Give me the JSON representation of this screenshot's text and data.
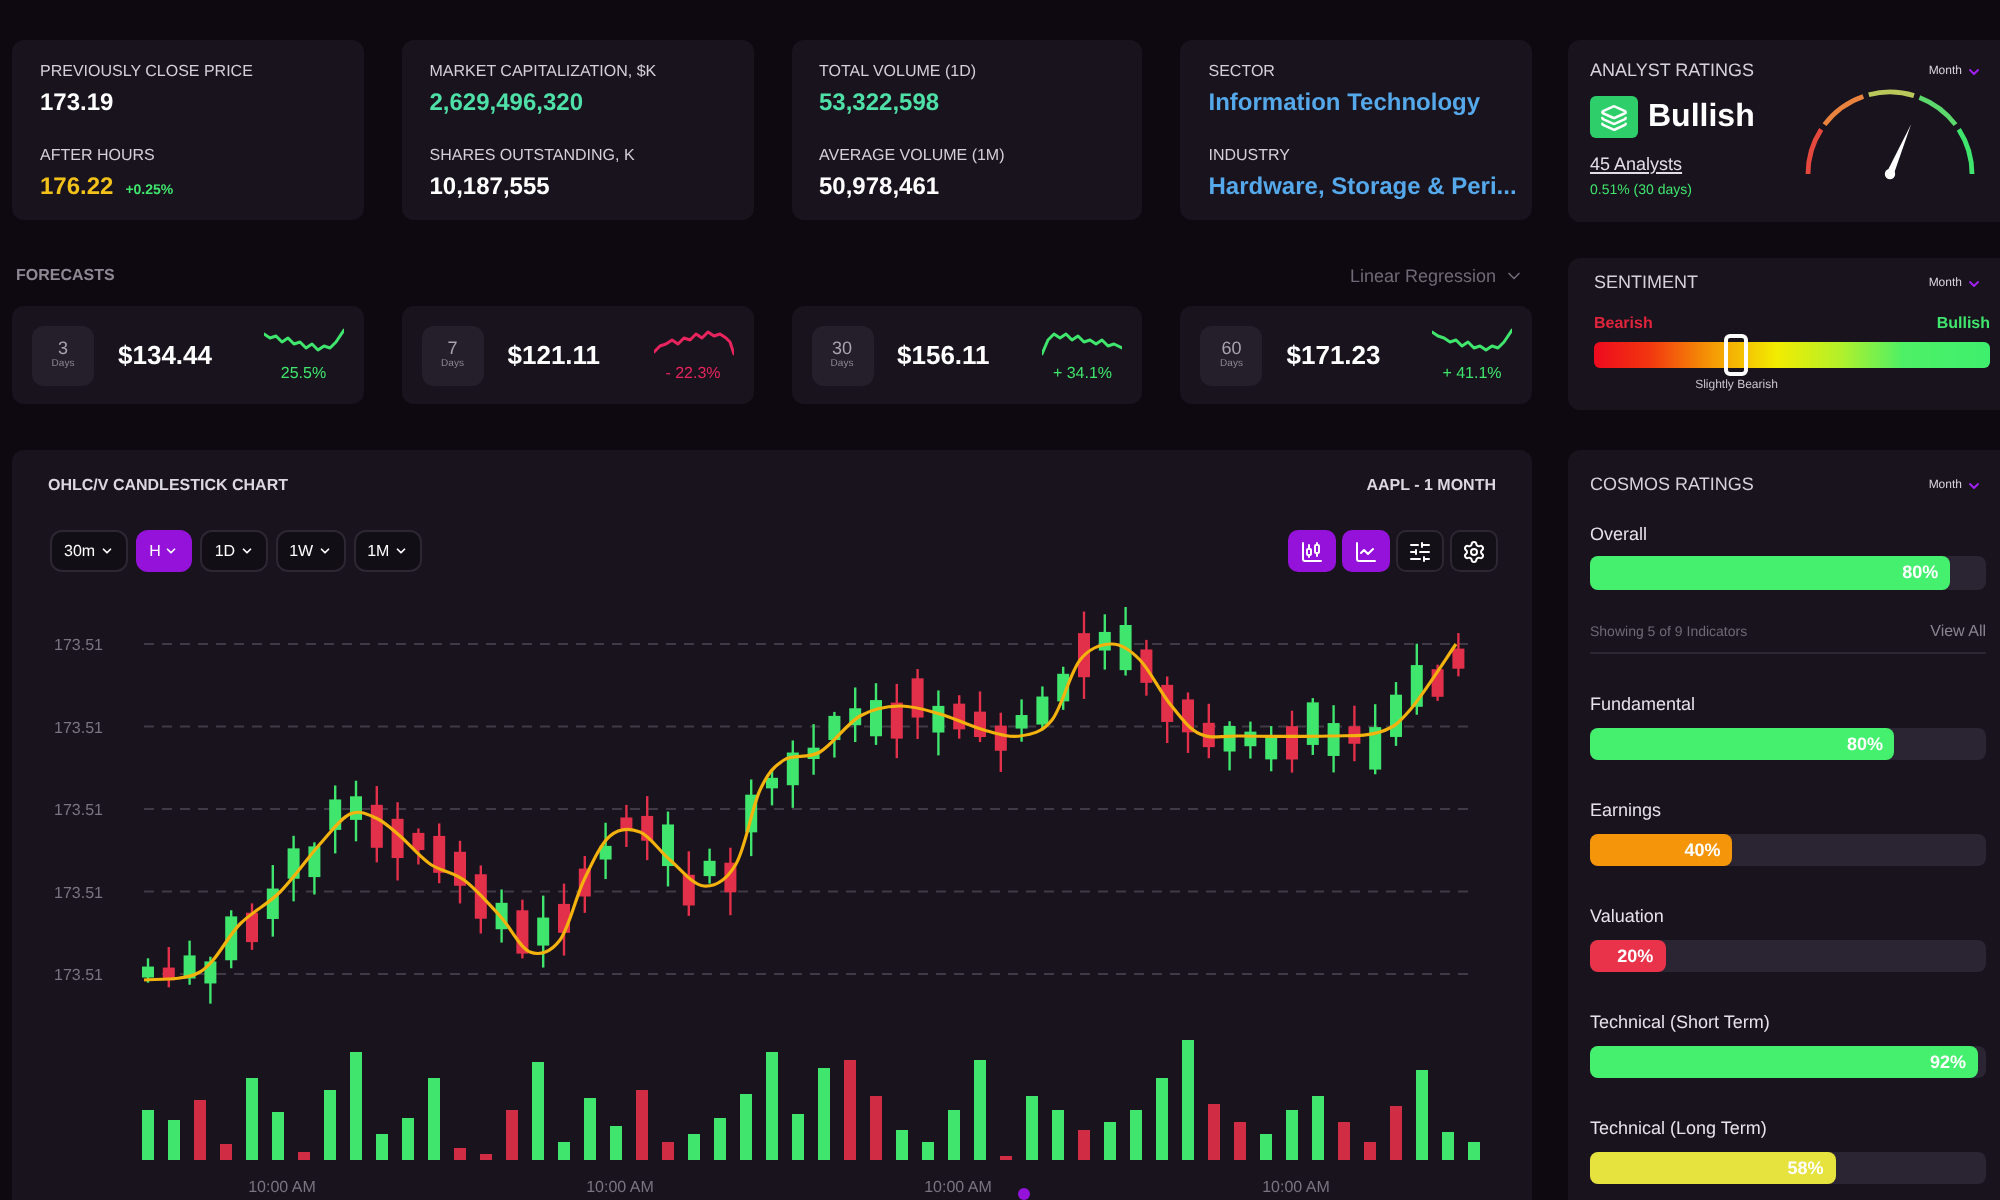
{
  "stats": [
    {
      "items": [
        {
          "label": "PREVIOUSLY CLOSE PRICE",
          "value": "173.19",
          "color": "#ffffff"
        },
        {
          "label": "AFTER HOURS",
          "value": "176.22",
          "color": "#f2c21b",
          "change": "+0.25%"
        }
      ]
    },
    {
      "items": [
        {
          "label": "MARKET CAPITALIZATION, $K",
          "value": "2,629,496,320",
          "color": "#4fe0a8"
        },
        {
          "label": "SHARES OUTSTANDING, K",
          "value": "10,187,555",
          "color": "#ffffff"
        }
      ]
    },
    {
      "items": [
        {
          "label": "TOTAL VOLUME (1D)",
          "value": "53,322,598",
          "color": "#4fe0a8"
        },
        {
          "label": "AVERAGE VOLUME (1M)",
          "value": "50,978,461",
          "color": "#ffffff"
        }
      ]
    },
    {
      "items": [
        {
          "label": "SECTOR",
          "value": "Information Technology",
          "color": "#55a8ea"
        },
        {
          "label": "INDUSTRY",
          "value": "Hardware, Storage & Peri...",
          "color": "#55a8ea"
        }
      ]
    }
  ],
  "forecasts": {
    "title": "FORECASTS",
    "method": "Linear Regression",
    "items": [
      {
        "days": "3",
        "unit": "Days",
        "price": "$134.44",
        "change": "25.5%",
        "color": "#3fe56c"
      },
      {
        "days": "7",
        "unit": "Days",
        "price": "$121.11",
        "change": "- 22.3%",
        "color": "#e8245e"
      },
      {
        "days": "30",
        "unit": "Days",
        "price": "$156.11",
        "change": "+ 34.1%",
        "color": "#3fe56c"
      },
      {
        "days": "60",
        "unit": "Days",
        "price": "$171.23",
        "change": "+ 41.1%",
        "color": "#3fe56c"
      }
    ]
  },
  "chart": {
    "title": "OHLC/V CANDLESTICK CHART",
    "symbol": "AAPL - 1 MONTH",
    "timeframes": [
      {
        "label": "30m",
        "selected": false
      },
      {
        "label": "H",
        "selected": true
      },
      {
        "label": "1D",
        "selected": false
      },
      {
        "label": "1W",
        "selected": false
      },
      {
        "label": "1M",
        "selected": false
      }
    ],
    "tools": [
      {
        "kind": "candles",
        "selected": true
      },
      {
        "kind": "line",
        "selected": true
      },
      {
        "kind": "sliders",
        "selected": false
      },
      {
        "kind": "settings",
        "selected": false
      }
    ],
    "y_labels": [
      "173.51",
      "173.51",
      "173.51",
      "173.51",
      "173.51"
    ],
    "x_labels": [
      "10:00 AM",
      "10:00 AM",
      "10:00 AM",
      "10:00 AM"
    ]
  },
  "analyst_ratings": {
    "title": "ANALYST RATINGS",
    "period": "Month",
    "rating": "Bullish",
    "analysts": "45 Analysts",
    "change": "0.51% (30 days)"
  },
  "sentiment": {
    "title": "SENTIMENT",
    "period": "Month",
    "low_label": "Bearish",
    "high_label": "Bullish",
    "level": 0.36,
    "reading": "Slightly Bearish"
  },
  "cosmos_ratings": {
    "title": "COSMOS RATINGS",
    "period": "Month",
    "overall": {
      "label": "Overall",
      "value": "80%",
      "level": 0.91
    },
    "summary": "Showing 5 of 9 Indicators",
    "view_all": "View All",
    "indicators": [
      {
        "label": "Fundamental",
        "value": "80%",
        "level": 0.77,
        "color": "#44f06e"
      },
      {
        "label": "Earnings",
        "value": "40%",
        "level": 0.36,
        "color": "#f5960a"
      },
      {
        "label": "Valuation",
        "value": "20%",
        "level": 0.19,
        "color": "#e8334a"
      },
      {
        "label": "Technical (Short Term)",
        "value": "92%",
        "level": 0.98,
        "color": "#44f06e"
      },
      {
        "label": "Technical (Long Term)",
        "value": "58%",
        "level": 0.62,
        "color": "#e6e23e"
      }
    ]
  }
}
